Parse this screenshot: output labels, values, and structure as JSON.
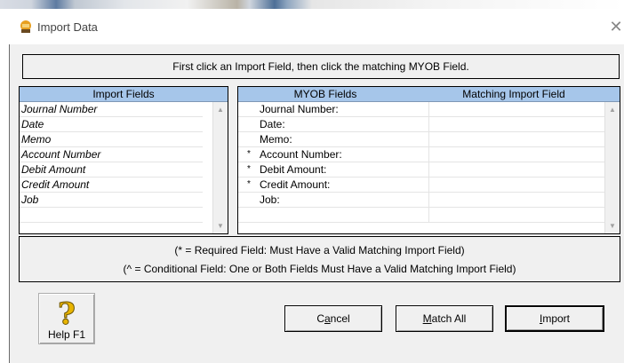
{
  "window": {
    "title": "Import Data",
    "close_glyph": "✕",
    "icon": "myob-import-icon"
  },
  "instruction": "First click an Import Field, then click the matching MYOB Field.",
  "import_fields": {
    "header": "Import Fields",
    "items": [
      "Journal Number",
      "Date",
      "Memo",
      "Account Number",
      "Debit Amount",
      "Credit Amount",
      "Job",
      "",
      ""
    ]
  },
  "myob_fields": {
    "header_field": "MYOB Fields",
    "header_match": "Matching Import Field",
    "items": [
      {
        "mark": "",
        "label": "Journal Number:",
        "match": ""
      },
      {
        "mark": "",
        "label": "Date:",
        "match": ""
      },
      {
        "mark": "",
        "label": "Memo:",
        "match": ""
      },
      {
        "mark": "*",
        "label": "Account Number:",
        "match": ""
      },
      {
        "mark": "*",
        "label": "Debit Amount:",
        "match": ""
      },
      {
        "mark": "*",
        "label": "Credit Amount:",
        "match": ""
      },
      {
        "mark": "",
        "label": "Job:",
        "match": ""
      },
      {
        "mark": "",
        "label": "",
        "match": ""
      },
      {
        "mark": "",
        "label": "",
        "match": ""
      }
    ]
  },
  "legend": {
    "required": "(* = Required Field:  Must Have a Valid Matching Import Field)",
    "conditional": "(^ = Conditional Field:  One or Both Fields Must Have a Valid Matching Import Field)"
  },
  "buttons": {
    "help": "Help F1",
    "cancel_pre": "C",
    "cancel_ul": "a",
    "cancel_post": "ncel",
    "matchall_ul": "M",
    "matchall_post": "atch All",
    "import_ul": "I",
    "import_post": "mport"
  },
  "colors": {
    "header_bg": "#a6c6ea",
    "dialog_bg": "#f0f0f0",
    "help_icon": "#e8b400"
  }
}
